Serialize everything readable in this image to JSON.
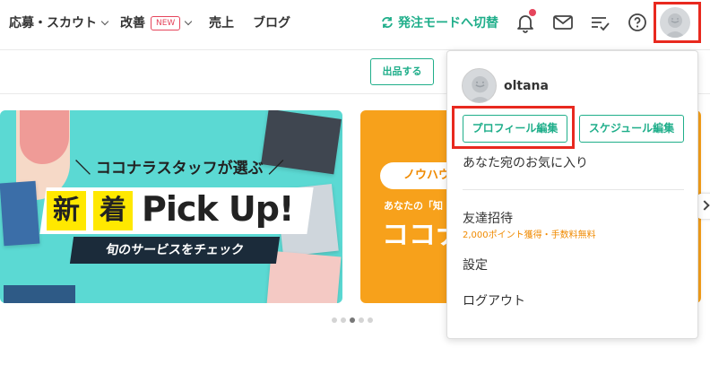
{
  "nav": {
    "items": [
      {
        "label": "応募・スカウト"
      },
      {
        "label": "改善",
        "badge": "NEW"
      },
      {
        "label": "売上"
      },
      {
        "label": "ブログ"
      }
    ],
    "switch_mode": "発注モードへ切替",
    "icons": [
      "bell-icon",
      "mail-icon",
      "task-list-icon",
      "help-icon",
      "user-avatar"
    ]
  },
  "toolbar": {
    "listing_button": "出品する"
  },
  "banner1": {
    "title": "ココナラスタッフが選ぶ",
    "char1": "新",
    "char2": "着",
    "pickup": "Pick Up!",
    "subtitle": "旬のサービスをチェック"
  },
  "banner2": {
    "pill": "ノウハウ",
    "small_text": "あなたの「知",
    "big_text": "ココナ"
  },
  "dropdown": {
    "username": "oltana",
    "profile_edit": "プロフィール編集",
    "schedule_edit": "スケジュール編集",
    "favorites": "あなた宛のお気に入り",
    "invite": "友達招待",
    "invite_note": "2,000ポイント獲得・手数料無料",
    "settings": "設定",
    "logout": "ログアウト"
  },
  "colors": {
    "accent": "#1fae8a",
    "highlight": "#e8291f",
    "badge": "#e5455c",
    "banner1_bg": "#5bd9d3",
    "banner2_bg": "#f7a11b"
  }
}
